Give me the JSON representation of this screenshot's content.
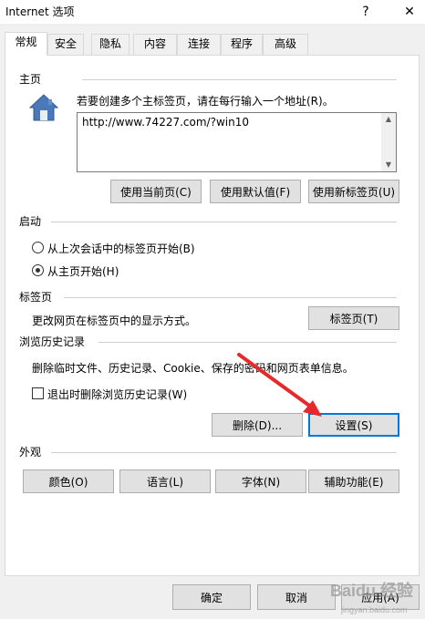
{
  "window": {
    "title": "Internet 选项",
    "help_glyph": "?",
    "close_glyph": "✕"
  },
  "tabs": [
    {
      "label": "常规",
      "active": true
    },
    {
      "label": "安全"
    },
    {
      "label": "隐私"
    },
    {
      "label": "内容"
    },
    {
      "label": "连接"
    },
    {
      "label": "程序"
    },
    {
      "label": "高级"
    }
  ],
  "homepage": {
    "title": "主页",
    "description": "若要创建多个主标签页，请在每行输入一个地址(R)。",
    "url": "http://www.74227.com/?win10",
    "buttons": {
      "use_current": "使用当前页(C)",
      "use_default": "使用默认值(F)",
      "use_new_tab": "使用新标签页(U)"
    }
  },
  "startup": {
    "title": "启动",
    "options": [
      {
        "label": "从上次会话中的标签页开始(B)",
        "selected": false
      },
      {
        "label": "从主页开始(H)",
        "selected": true
      }
    ]
  },
  "tabs_section": {
    "title": "标签页",
    "description": "更改网页在标签页中的显示方式。",
    "button": "标签页(T)"
  },
  "history": {
    "title": "浏览历史记录",
    "description": "删除临时文件、历史记录、Cookie、保存的密码和网页表单信息。",
    "checkbox_label": "退出时删除浏览历史记录(W)",
    "checkbox_checked": false,
    "delete_button": "删除(D)...",
    "settings_button": "设置(S)"
  },
  "appearance": {
    "title": "外观",
    "buttons": {
      "colors": "颜色(O)",
      "languages": "语言(L)",
      "fonts": "字体(N)",
      "accessibility": "辅助功能(E)"
    }
  },
  "footer": {
    "ok": "确定",
    "cancel": "取消",
    "apply": "应用(A)"
  },
  "annotation": {
    "arrow_color": "#e8282a"
  },
  "watermark": {
    "text": "Baidu 经验",
    "url": "jingyan.baidu.com"
  }
}
